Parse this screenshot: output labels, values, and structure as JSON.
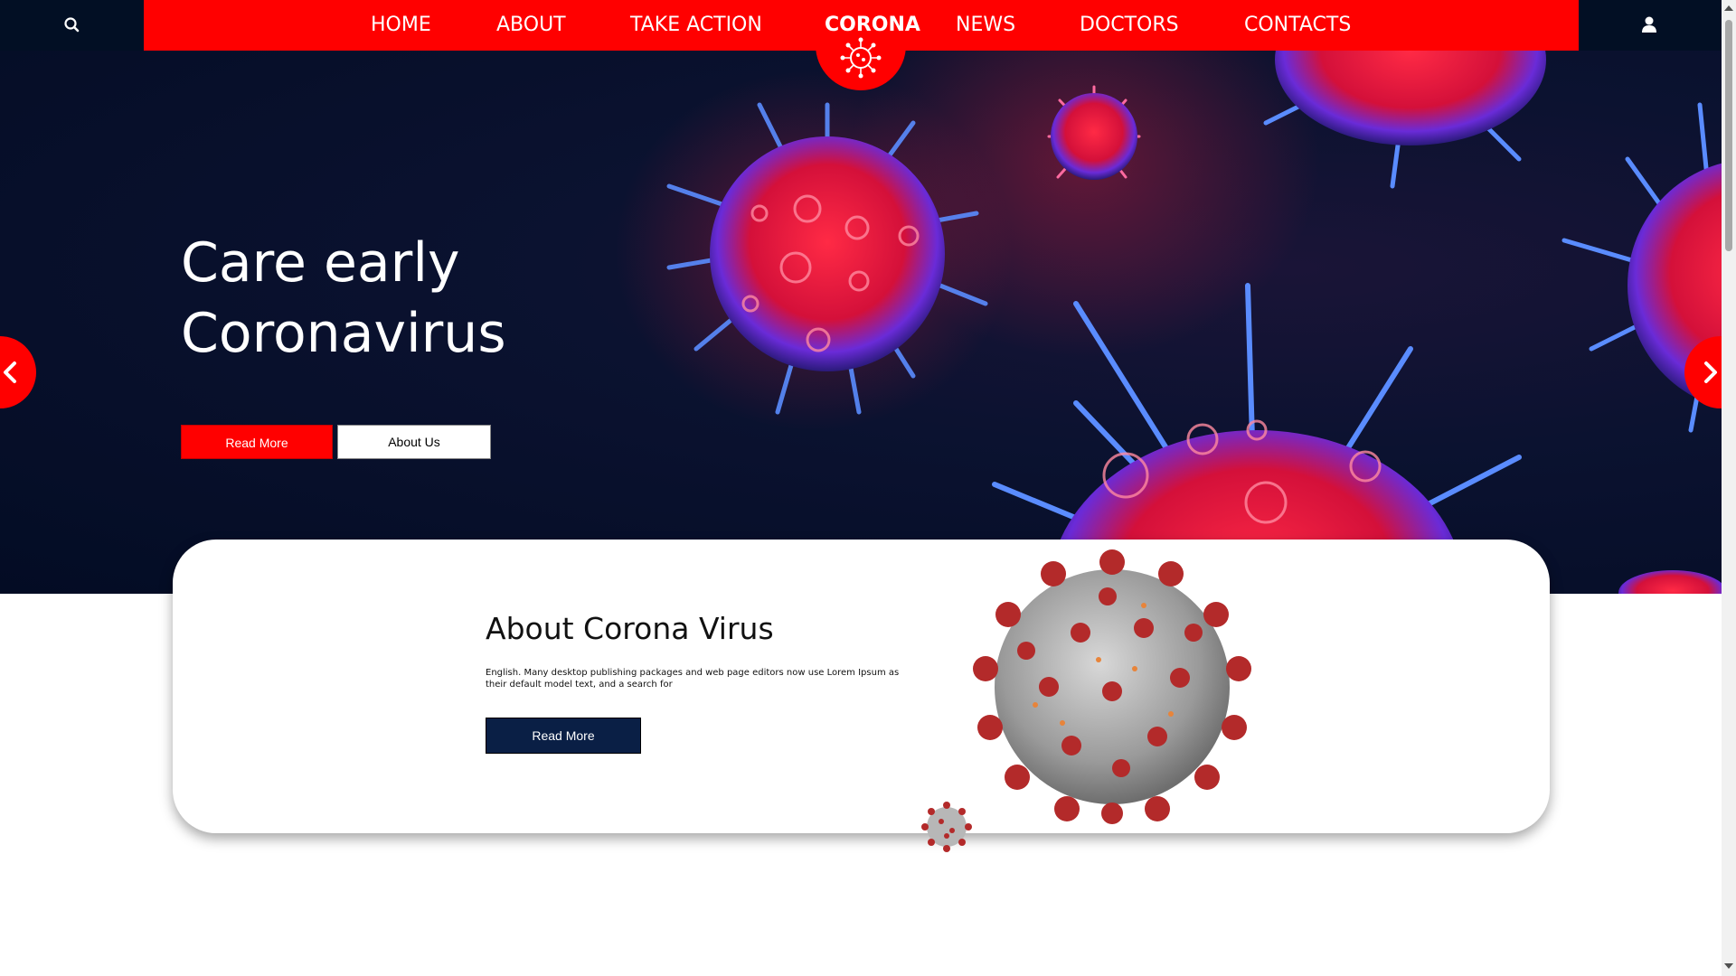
{
  "nav": {
    "items": [
      {
        "label": "HOME"
      },
      {
        "label": "ABOUT"
      },
      {
        "label": "TAKE ACTION"
      },
      {
        "label": "NEWS"
      },
      {
        "label": "DOCTORS"
      },
      {
        "label": "CONTACTS"
      }
    ],
    "logo_text": "CORONA",
    "search_icon": "search-icon",
    "user_icon": "user-icon"
  },
  "hero": {
    "title_line1": "Care early",
    "title_line2": "Coronavirus",
    "read_more_label": "Read More",
    "about_us_label": "About Us",
    "prev_icon": "chevron-left-icon",
    "next_icon": "chevron-right-icon"
  },
  "about": {
    "title": "About Corona Virus",
    "text": "English. Many desktop publishing packages and web page editors now use Lorem Ipsum as their default model text, and a search for",
    "button_label": "Read More"
  },
  "colors": {
    "brand_red": "#ff0000",
    "navy": "#020f24",
    "button_navy": "#0a1f45"
  }
}
